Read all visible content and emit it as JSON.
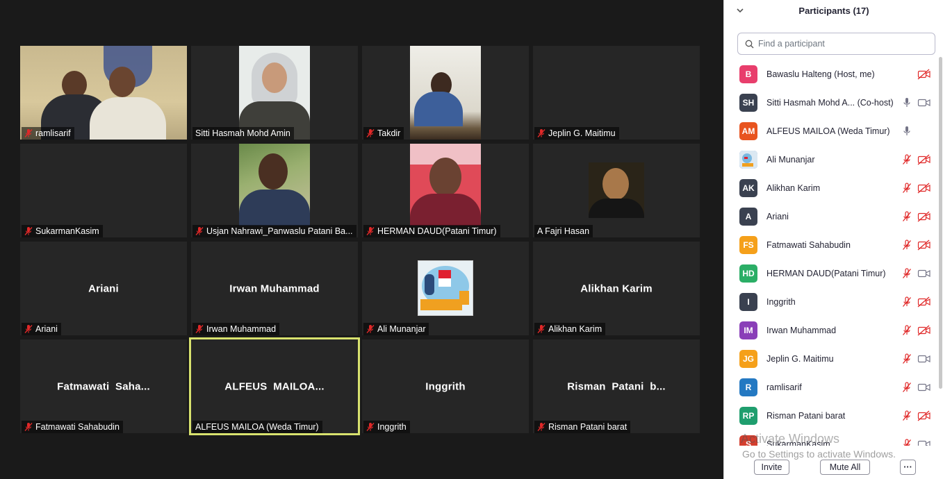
{
  "tiles": [
    {
      "label": "ramlisarif",
      "muted": true,
      "center": ""
    },
    {
      "label": "Sitti Hasmah Mohd Amin",
      "muted": false,
      "center": ""
    },
    {
      "label": "Takdir",
      "muted": true,
      "center": ""
    },
    {
      "label": "Jeplin G. Maitimu",
      "muted": true,
      "center": ""
    },
    {
      "label": "SukarmanKasim",
      "muted": true,
      "center": ""
    },
    {
      "label": "Usjan  Nahrawi_Panwaslu Patani Ba...",
      "muted": true,
      "center": ""
    },
    {
      "label": "HERMAN DAUD(Patani Timur)",
      "muted": true,
      "center": ""
    },
    {
      "label": "A Fajri Hasan",
      "muted": false,
      "center": ""
    },
    {
      "label": "Ariani",
      "muted": true,
      "center": "Ariani"
    },
    {
      "label": "Irwan Muhammad",
      "muted": true,
      "center": "Irwan Muhammad"
    },
    {
      "label": "Ali Munanjar",
      "muted": true,
      "center": ""
    },
    {
      "label": "Alikhan Karim",
      "muted": true,
      "center": "Alikhan Karim"
    },
    {
      "label": "Fatmawati Sahabudin",
      "muted": true,
      "center": "Fatmawati  Saha..."
    },
    {
      "label": "ALFEUS MAILOA (Weda Timur)",
      "muted": false,
      "center": "ALFEUS  MAILOA..."
    },
    {
      "label": "Inggrith",
      "muted": true,
      "center": "Inggrith"
    },
    {
      "label": "Risman Patani barat",
      "muted": true,
      "center": "Risman  Patani  b..."
    }
  ],
  "panel": {
    "title": "Participants (17)",
    "search_placeholder": "Find a participant",
    "invite_label": "Invite",
    "mute_all_label": "Mute All",
    "more_label": "···"
  },
  "participants": [
    {
      "initials": "B",
      "color": "#e83e6c",
      "name": "Bawaslu Halteng (Host, me)",
      "mic": "none",
      "cam": "off"
    },
    {
      "initials": "SH",
      "color": "#3a4150",
      "name": "Sitti Hasmah Mohd A... (Co-host)",
      "mic": "on",
      "cam": "on"
    },
    {
      "initials": "AM",
      "color": "#e8541f",
      "name": "ALFEUS MAILOA (Weda Timur)",
      "mic": "on",
      "cam": "none"
    },
    {
      "initials": "",
      "color": "#5a7ab8",
      "name": "Ali Munanjar",
      "mic": "off",
      "cam": "off"
    },
    {
      "initials": "AK",
      "color": "#3a4150",
      "name": "Alikhan Karim",
      "mic": "off",
      "cam": "off"
    },
    {
      "initials": "A",
      "color": "#3a4150",
      "name": "Ariani",
      "mic": "off",
      "cam": "off"
    },
    {
      "initials": "FS",
      "color": "#f5a01a",
      "name": "Fatmawati Sahabudin",
      "mic": "off",
      "cam": "off"
    },
    {
      "initials": "HD",
      "color": "#2bae66",
      "name": "HERMAN DAUD(Patani Timur)",
      "mic": "off",
      "cam": "on"
    },
    {
      "initials": "I",
      "color": "#3a4150",
      "name": "Inggrith",
      "mic": "off",
      "cam": "off"
    },
    {
      "initials": "IM",
      "color": "#8a3fb8",
      "name": "Irwan Muhammad",
      "mic": "off",
      "cam": "off"
    },
    {
      "initials": "JG",
      "color": "#f5a01a",
      "name": "Jeplin G. Maitimu",
      "mic": "off",
      "cam": "on"
    },
    {
      "initials": "R",
      "color": "#2479c2",
      "name": "ramlisarif",
      "mic": "off",
      "cam": "on"
    },
    {
      "initials": "RP",
      "color": "#1f9e6e",
      "name": "Risman Patani barat",
      "mic": "off",
      "cam": "off"
    },
    {
      "initials": "S",
      "color": "#d43f2f",
      "name": "SukarmanKasim",
      "mic": "off",
      "cam": "on"
    }
  ],
  "watermark": {
    "line1": "Activate Windows",
    "line2": "Go to Settings to activate Windows."
  },
  "colors": {
    "active_border": "#d8e26e",
    "muted_red": "#e02828",
    "tile_bg": "#262626"
  },
  "icons": {
    "mic_off": "mic-off-icon",
    "mic_on": "mic-icon",
    "cam_off": "camera-off-icon",
    "cam_on": "camera-icon",
    "search": "search-icon",
    "collapse": "chevron-down-icon"
  }
}
